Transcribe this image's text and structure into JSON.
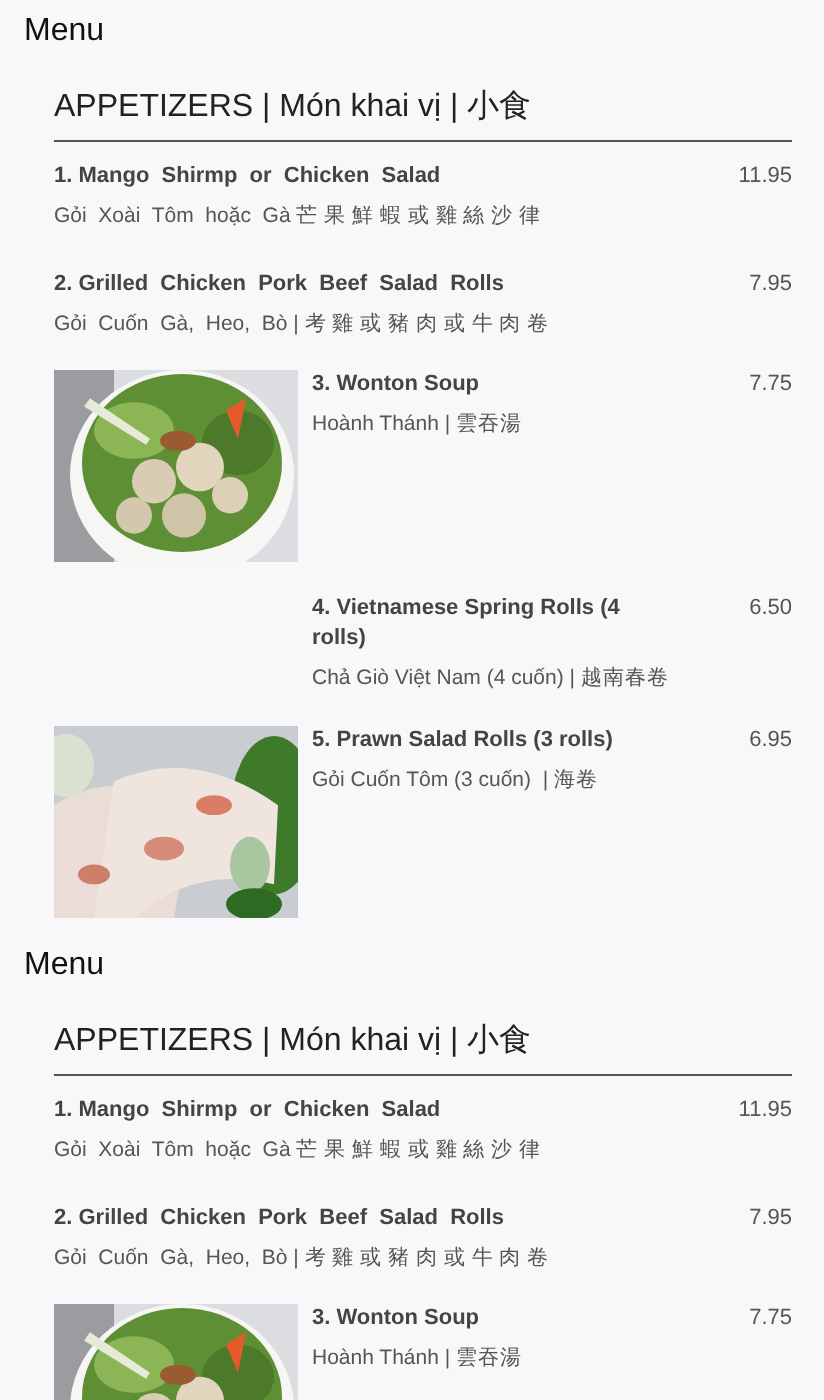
{
  "sections": [
    {
      "title": "Menu",
      "category": "APPETIZERS | Món khai vị | 小食",
      "items": [
        {
          "kind": "plain",
          "name": "1. Mango  Shirmp  or  Chicken  Salad",
          "price": "11.95",
          "subtitle": "Gỏi  Xoài  Tôm  hoặc  Gà 芒 果 鮮 蝦 或 雞 絲 沙 律"
        },
        {
          "kind": "plain",
          "name": "2. Grilled  Chicken  Pork  Beef  Salad  Rolls",
          "price": "7.95",
          "subtitle": "Gỏi  Cuốn  Gà,  Heo,  Bò | 考 雞 或 豬 肉 或 牛 肉 卷"
        },
        {
          "kind": "soup-photo",
          "name": "3. Wonton Soup",
          "price": "7.75",
          "subtitle": "Hoành Thánh | 雲吞湯"
        },
        {
          "kind": "no-photo",
          "name": "4. Vietnamese Spring Rolls (4 rolls)",
          "price": "6.50",
          "subtitle": "Chả Giò Việt Nam (4 cuốn) | 越南春卷"
        },
        {
          "kind": "rolls-photo",
          "name": "5. Prawn Salad Rolls (3 rolls)",
          "price": "6.95",
          "subtitle": "Gỏi Cuốn Tôm (3 cuốn)  | 海卷"
        }
      ]
    },
    {
      "title": "Menu",
      "category": "APPETIZERS | Món khai vị | 小食",
      "items": [
        {
          "kind": "plain",
          "name": "1. Mango  Shirmp  or  Chicken  Salad",
          "price": "11.95",
          "subtitle": "Gỏi  Xoài  Tôm  hoặc  Gà 芒 果 鮮 蝦 或 雞 絲 沙 律"
        },
        {
          "kind": "plain",
          "name": "2. Grilled  Chicken  Pork  Beef  Salad  Rolls",
          "price": "7.95",
          "subtitle": "Gỏi  Cuốn  Gà,  Heo,  Bò | 考 雞 或 豬 肉 或 牛 肉 卷"
        },
        {
          "kind": "soup-photo",
          "name": "3. Wonton Soup",
          "price": "7.75",
          "subtitle": "Hoành Thánh | 雲吞湯"
        }
      ]
    }
  ]
}
